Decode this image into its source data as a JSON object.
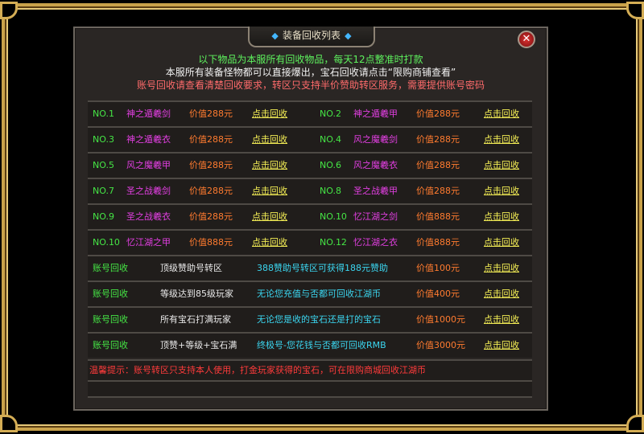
{
  "title": "装备回收列表",
  "title_decor": "◆",
  "close_label": "✕",
  "intro": {
    "line1": "以下物品为本服所有回收物品，每天12点整准时打款",
    "line2": "本服所有装备怪物都可以直接爆出，宝石回收请点击“限购商铺查看”",
    "line3": "账号回收请查看清楚回收要求，转区只支持半价赞助转区服务，需要提供账号密码"
  },
  "items": [
    {
      "no": "NO.1",
      "name": "神之遁羲剑",
      "price": "价值288元",
      "action": "点击回收"
    },
    {
      "no": "NO.2",
      "name": "神之遁羲甲",
      "price": "价值288元",
      "action": "点击回收"
    },
    {
      "no": "NO.3",
      "name": "神之遁羲衣",
      "price": "价值288元",
      "action": "点击回收"
    },
    {
      "no": "NO.4",
      "name": "风之魔羲剑",
      "price": "价值288元",
      "action": "点击回收"
    },
    {
      "no": "NO.5",
      "name": "风之魔羲甲",
      "price": "价值288元",
      "action": "点击回收"
    },
    {
      "no": "NO.6",
      "name": "风之魔羲衣",
      "price": "价值288元",
      "action": "点击回收"
    },
    {
      "no": "NO.7",
      "name": "圣之战羲剑",
      "price": "价值288元",
      "action": "点击回收"
    },
    {
      "no": "NO.8",
      "name": "圣之战羲甲",
      "price": "价值288元",
      "action": "点击回收"
    },
    {
      "no": "NO.9",
      "name": "圣之战羲衣",
      "price": "价值288元",
      "action": "点击回收"
    },
    {
      "no": "NO.10",
      "name": "忆江湖之剑",
      "price": "价值888元",
      "action": "点击回收"
    },
    {
      "no": "NO.10",
      "name": "忆江湖之甲",
      "price": "价值888元",
      "action": "点击回收"
    },
    {
      "no": "NO.12",
      "name": "忆江湖之衣",
      "price": "价值888元",
      "action": "点击回收"
    }
  ],
  "accounts": [
    {
      "type": "账号回收",
      "req": "顶级赞助号转区",
      "desc": "388赞助号转区可获得188元赞助",
      "price": "价值100元",
      "action": "点击回收"
    },
    {
      "type": "账号回收",
      "req": "等级达到85级玩家",
      "desc": "无论您充值与否都可回收江湖币",
      "price": "价值400元",
      "action": "点击回收"
    },
    {
      "type": "账号回收",
      "req": "所有宝石打满玩家",
      "desc": "无论您是收的宝石还是打的宝石",
      "price": "价值1000元",
      "action": "点击回收"
    },
    {
      "type": "账号回收",
      "req": "顶赞+等级+宝石满",
      "desc": "终极号-您花钱与否都可回收RMB",
      "price": "价值3000元",
      "action": "点击回收"
    }
  ],
  "warning": "温馨提示：账号转区只支持本人使用，打金玩家获得的宝石，可在限购商城回收江湖币",
  "colors": {
    "green": "#45e545",
    "magenta": "#e23fe2",
    "orange": "#ff7b2f",
    "yellow": "#f4ee55",
    "cyan": "#3bd6f0",
    "red": "#ff3b3b",
    "gold": "#c9a24a"
  }
}
